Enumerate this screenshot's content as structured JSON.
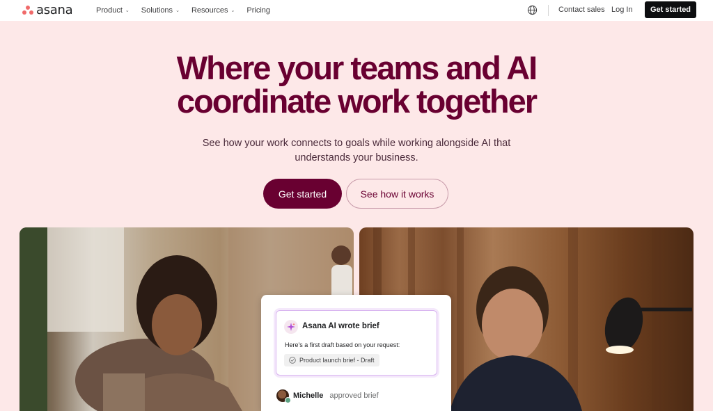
{
  "nav": {
    "logo_text": "asana",
    "links": [
      {
        "label": "Product",
        "has_dropdown": true
      },
      {
        "label": "Solutions",
        "has_dropdown": true
      },
      {
        "label": "Resources",
        "has_dropdown": true
      },
      {
        "label": "Pricing",
        "has_dropdown": false
      }
    ],
    "language_icon": "globe-icon",
    "contact_label": "Contact sales",
    "login_label": "Log In",
    "cta_label": "Get started"
  },
  "hero": {
    "headline_line1": "Where your teams and AI",
    "headline_line2": "coordinate work together",
    "subtitle_line1": "See how your work connects to goals while working alongside AI that",
    "subtitle_line2": "understands your business.",
    "primary_button": "Get started",
    "secondary_button": "See how it works"
  },
  "ai_card": {
    "title": "Asana AI wrote brief",
    "body": "Here's a first draft based on your request:",
    "chip_label": "Product launch brief - Draft",
    "approver_name": "Michelle",
    "approver_action": "approved brief"
  },
  "colors": {
    "brand_accent": "#690031",
    "logo_coral": "#f06a6a",
    "hero_background": "#fde8e8"
  }
}
